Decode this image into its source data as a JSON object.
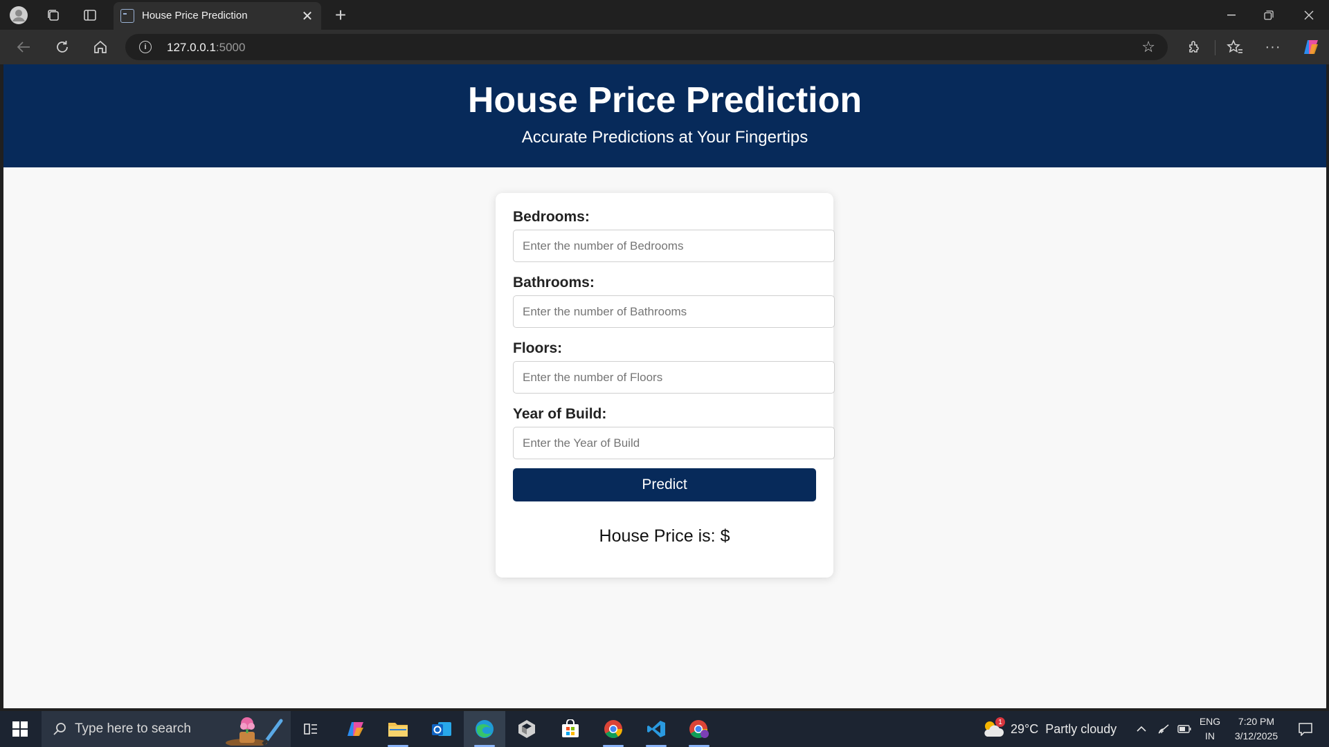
{
  "browser": {
    "tab_title": "House Price Prediction",
    "url_host": "127.0.0.1",
    "url_port": ":5000"
  },
  "page": {
    "header_title": "House Price Prediction",
    "header_subtitle": "Accurate Predictions at Your Fingertips",
    "form": {
      "fields": [
        {
          "label": "Bedrooms:",
          "placeholder": "Enter the number of Bedrooms",
          "value": ""
        },
        {
          "label": "Bathrooms:",
          "placeholder": "Enter the number of Bathrooms",
          "value": ""
        },
        {
          "label": "Floors:",
          "placeholder": "Enter the number of Floors",
          "value": ""
        },
        {
          "label": "Year of Build:",
          "placeholder": "Enter the Year of Build",
          "value": ""
        }
      ],
      "submit_label": "Predict"
    },
    "result_text": "House Price is: $"
  },
  "taskbar": {
    "search_placeholder": "Type here to search",
    "weather": "29°C  Partly cloudy",
    "weather_badge": "1",
    "lang": "ENG",
    "region": "IN",
    "time": "7:20 PM",
    "date": "3/12/2025",
    "apps": [
      "task-view",
      "copilot",
      "file-explorer",
      "outlook",
      "edge",
      "unity",
      "microsoft-store",
      "chrome",
      "vscode",
      "chrome-profile"
    ]
  },
  "colors": {
    "header_bg": "#072a5a",
    "button_bg": "#072a5a",
    "page_bg": "#f8f8f8"
  }
}
